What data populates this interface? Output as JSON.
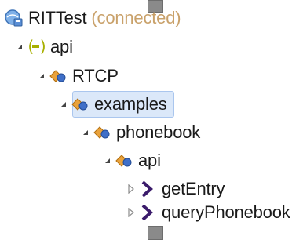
{
  "tree": {
    "root": {
      "label": "RITTest",
      "status": "(connected)",
      "icon": "project-icon"
    },
    "nodes": [
      {
        "label": "api",
        "icon": "package-icon"
      },
      {
        "label": "RTCP",
        "icon": "service-component-icon"
      },
      {
        "label": "examples",
        "icon": "service-component-icon",
        "selected": true
      },
      {
        "label": "phonebook",
        "icon": "service-component-icon"
      },
      {
        "label": "api",
        "icon": "service-component-icon"
      },
      {
        "label": "getEntry",
        "icon": "operation-chevron-icon"
      },
      {
        "label": "queryPhonebook",
        "icon": "operation-chevron-icon"
      }
    ]
  },
  "colors": {
    "selection_background": "#dbe8f9",
    "selection_border": "#aac6ee",
    "status_text": "#c9a16a",
    "operation_icon": "#3b1b6b",
    "package_icon": "#b0b000"
  }
}
